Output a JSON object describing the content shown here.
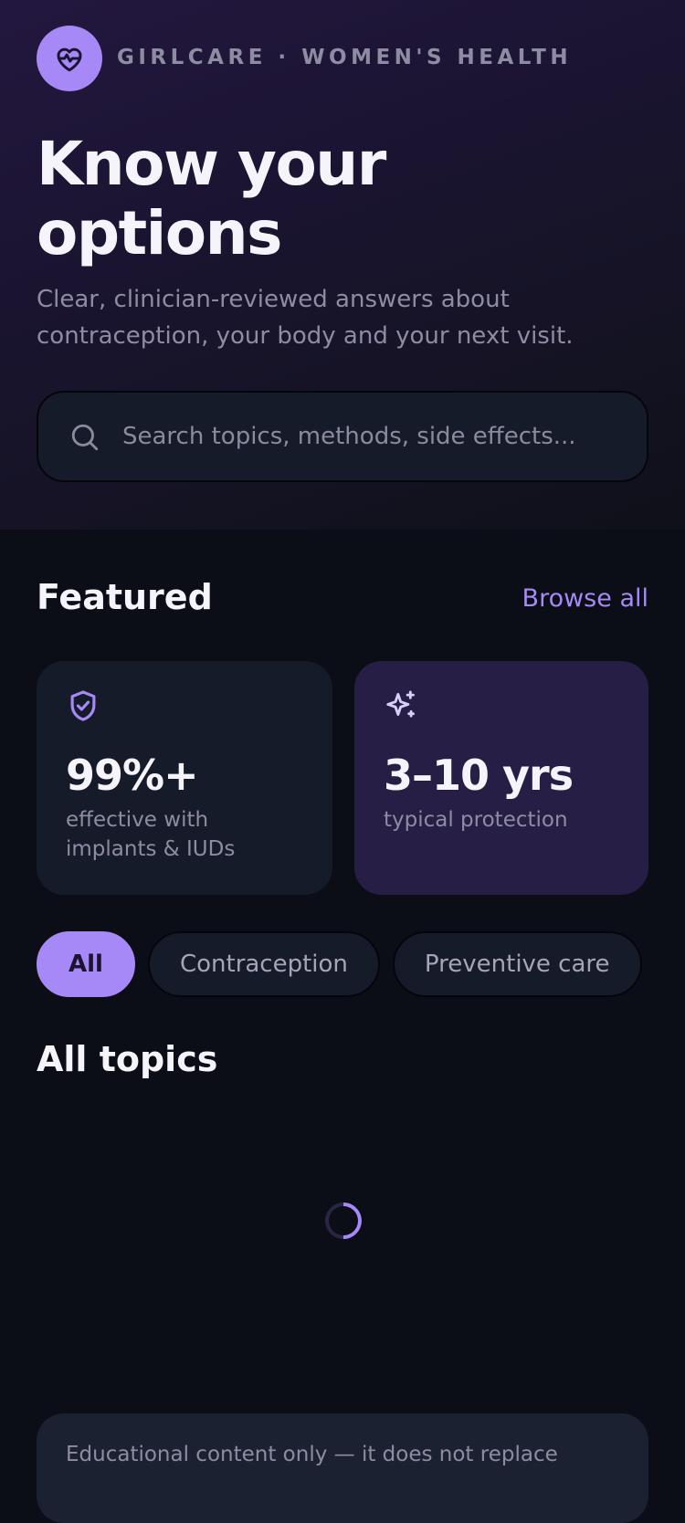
{
  "brand": {
    "name": "GIRLCARE · WOMEN'S HEALTH",
    "logo_icon": "heart-pulse-icon"
  },
  "hero": {
    "title": "Know your options",
    "subtitle": "Clear, clinician-reviewed answers about contraception, your body and your next visit."
  },
  "search": {
    "placeholder": "Search topics, methods, side effects...",
    "value": ""
  },
  "featured": {
    "title": "Featured",
    "browse_all_label": "Browse all",
    "cards": [
      {
        "icon": "shield-check-icon",
        "value": "99%+",
        "label": "effective with implants & IUDs"
      },
      {
        "icon": "sparkles-icon",
        "value": "3–10 yrs",
        "label": "typical protection"
      }
    ]
  },
  "filters": {
    "chips": [
      {
        "label": "All",
        "active": true
      },
      {
        "label": "Contraception",
        "active": false
      },
      {
        "label": "Preventive care",
        "active": false
      }
    ]
  },
  "topics": {
    "title": "All topics",
    "loading": true
  },
  "disclaimer": {
    "text": "Educational content only — it does not replace"
  },
  "colors": {
    "accent": "#a688f7",
    "background": "#0b0e17",
    "card": "#161b29",
    "card_featured": "#271e46",
    "muted_text": "#8e8ca3"
  }
}
